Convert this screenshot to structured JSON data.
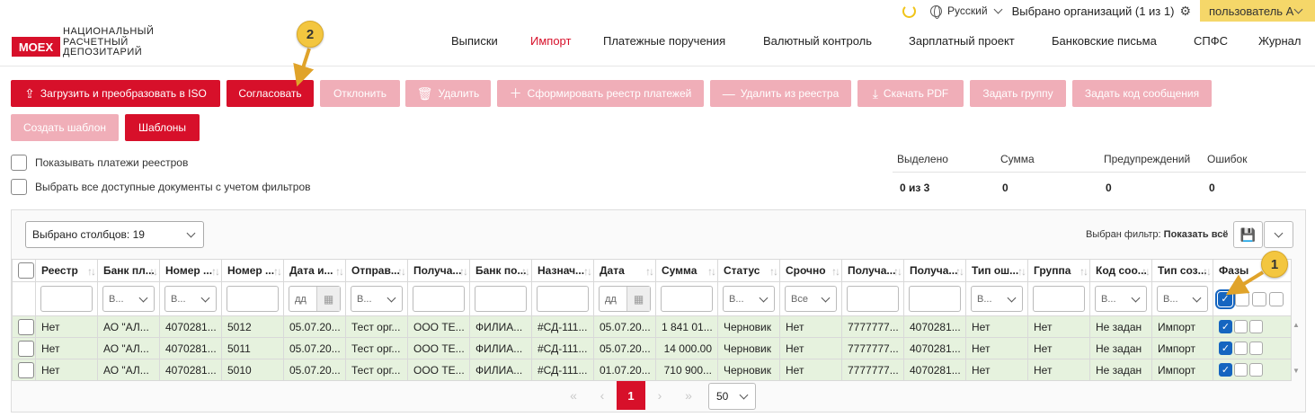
{
  "topbar": {
    "language": "Русский",
    "orgs_selected": "Выбрано организаций (1 из 1)",
    "user": "пользователь А"
  },
  "logo": {
    "mark": "MOEX",
    "line1": "НАЦИОНАЛЬНЫЙ",
    "line2": "РАСЧЕТНЫЙ",
    "line3": "ДЕПОЗИТАРИЙ"
  },
  "nav": {
    "active": "Импорт",
    "items": [
      "Выписки",
      "Импорт",
      "Платежные поручения",
      "Валютный контроль",
      "Зарплатный проект",
      "Банковские письма",
      "СПФС",
      "Журнал"
    ]
  },
  "toolbar": {
    "upload": "Загрузить и преобразовать в ISO",
    "approve": "Согласовать",
    "reject": "Отклонить",
    "delete": "Удалить",
    "form_registry": "Сформировать реестр платежей",
    "remove_registry": "Удалить из реестра",
    "download_pdf": "Скачать PDF",
    "set_group": "Задать группу",
    "set_msg_code": "Задать код сообщения",
    "create_template": "Создать шаблон",
    "templates": "Шаблоны"
  },
  "options": {
    "show_registry": "Показывать платежи реестров",
    "select_all": "Выбрать все доступные документы с учетом фильтров"
  },
  "stats": {
    "labels": [
      "Выделено",
      "Сумма",
      "Предупреждений",
      "Ошибок"
    ],
    "values": [
      "0 из 3",
      "0",
      "0",
      "0"
    ]
  },
  "grid": {
    "columns_selected": "Выбрано столбцов: 19",
    "filter_label": "Выбран фильтр:",
    "filter_value": "Показать всё",
    "headers": [
      "Реестр",
      "Банк пл...",
      "Номер ...",
      "Номер ...",
      "Дата и...",
      "Отправ...",
      "Получа...",
      "Банк по...",
      "Назнач...",
      "Дата",
      "Сумма",
      "Статус",
      "Срочно",
      "Получа...",
      "Получа...",
      "Тип ош...",
      "Группа",
      "Код соо...",
      "Тип соз...",
      "Фазы"
    ],
    "filters": {
      "select_short": "В...",
      "date_placeholder": "дд",
      "urgent": "Все"
    },
    "rows": [
      [
        "Нет",
        "АО \"АЛ...",
        "4070281...",
        "5012",
        "05.07.20...",
        "Тест орг...",
        "ООО ТЕ...",
        "ФИЛИА...",
        "#СД-111...",
        "05.07.20...",
        "1 841 01...",
        "Черновик",
        "Нет",
        "7777777...",
        "4070281...",
        "Нет",
        "Нет",
        "Не задан",
        "Импорт"
      ],
      [
        "Нет",
        "АО \"АЛ...",
        "4070281...",
        "5011",
        "05.07.20...",
        "Тест орг...",
        "ООО ТЕ...",
        "ФИЛИА...",
        "#СД-111...",
        "05.07.20...",
        "14 000.00",
        "Черновик",
        "Нет",
        "7777777...",
        "4070281...",
        "Нет",
        "Нет",
        "Не задан",
        "Импорт"
      ],
      [
        "Нет",
        "АО \"АЛ...",
        "4070281...",
        "5010",
        "05.07.20...",
        "Тест орг...",
        "ООО ТЕ...",
        "ФИЛИА...",
        "#СД-111...",
        "01.07.20...",
        "710 900...",
        "Черновик",
        "Нет",
        "7777777...",
        "4070281...",
        "Нет",
        "Нет",
        "Не задан",
        "Импорт"
      ]
    ]
  },
  "pagination": {
    "current": "1",
    "page_size": "50"
  },
  "callouts": [
    "1",
    "2"
  ],
  "colors": {
    "accent": "#d7102a",
    "disabled": "#f0aeb8",
    "row_bg": "#e6f2de",
    "user_bg": "#f5d769",
    "callout": "#f3c63f"
  }
}
